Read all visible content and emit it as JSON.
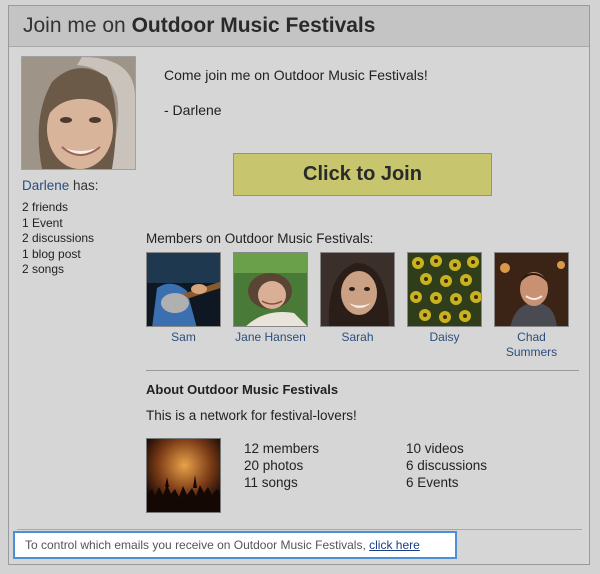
{
  "header": {
    "prefix": "Join me on ",
    "network": "Outdoor Music Festivals"
  },
  "sidebar": {
    "name": "Darlene",
    "has_label": " has:",
    "stats": [
      "2 friends",
      "1 Event",
      "2 discussions",
      "1 blog post",
      "2 songs"
    ]
  },
  "invite": {
    "message": "Come join me on Outdoor Music Festivals!",
    "signature": "- Darlene",
    "join_label": "Click to Join",
    "accent": "#c7c56e"
  },
  "members": {
    "label": "Members on Outdoor Music Festivals:",
    "list": [
      {
        "name": "Sam"
      },
      {
        "name": "Jane Hansen"
      },
      {
        "name": "Sarah"
      },
      {
        "name": "Daisy"
      },
      {
        "name": "Chad Summers"
      }
    ]
  },
  "about": {
    "title": "About Outdoor Music Festivals",
    "description": "This is a network for festival-lovers!",
    "counts_left": [
      "12 members",
      "20 photos",
      "11 songs"
    ],
    "counts_right": [
      "10 videos",
      "6 discussions",
      "6 Events"
    ]
  },
  "footer": {
    "text": "To control which emails you receive on Outdoor Music Festivals, ",
    "link": "click here"
  }
}
